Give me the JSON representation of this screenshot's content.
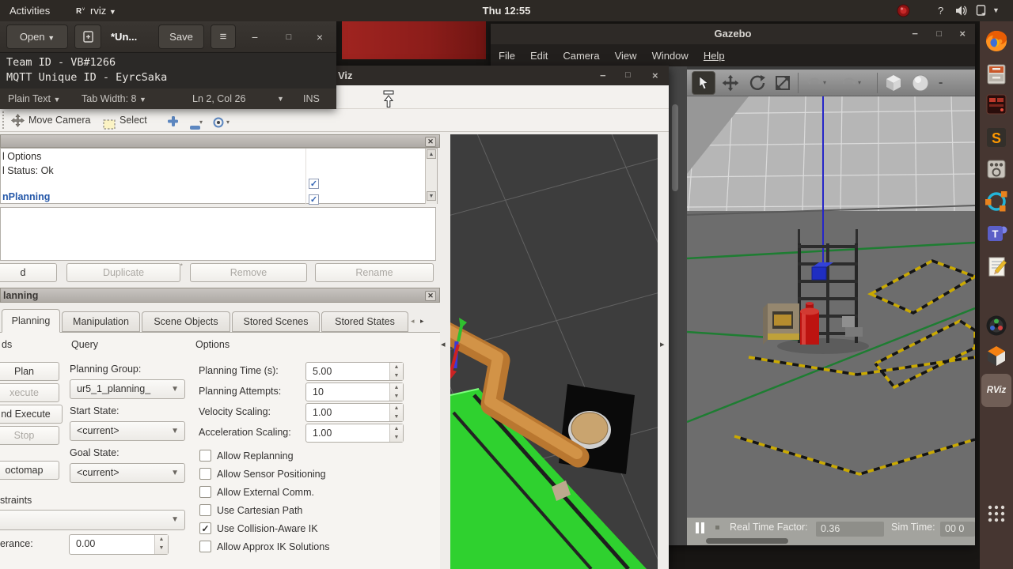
{
  "topbar": {
    "activities": "Activities",
    "app_name": "rviz",
    "clock": "Thu 12:55"
  },
  "gedit": {
    "open": "Open",
    "title": "*Un...",
    "save": "Save",
    "text_lines": [
      "Team ID - VB#1266",
      "MQTT Unique ID - EyrcSaka"
    ],
    "status": {
      "doc_type": "Plain Text",
      "tab_width": "Tab Width: 8",
      "cursor_pos": "Ln 2, Col 26",
      "mode": "INS"
    }
  },
  "rviz": {
    "title": "Viz",
    "toolbar": {
      "move_camera": "Move Camera",
      "select": "Select"
    },
    "displays": {
      "rows": [
        "l Options",
        "l Status: Ok"
      ],
      "planning_row": "nPlanning",
      "checks": [
        true,
        true
      ]
    },
    "display_buttons": {
      "add": "d",
      "duplicate": "Duplicate",
      "remove": "Remove",
      "rename": "Rename"
    },
    "motion_planning": {
      "title": "lanning",
      "tabs": [
        "Planning",
        "Manipulation",
        "Scene Objects",
        "Stored Scenes",
        "Stored States"
      ],
      "commands": {
        "label": "ds",
        "plan": "Plan",
        "execute": "xecute",
        "plan_execute": "nd Execute",
        "stop": "Stop",
        "octomap": "octomap"
      },
      "query": {
        "label": "Query",
        "planning_group_label": "Planning Group:",
        "planning_group_value": "ur5_1_planning_",
        "start_state_label": "Start State:",
        "start_state_value": "<current>",
        "goal_state_label": "Goal State:",
        "goal_state_value": "<current>"
      },
      "options": {
        "label": "Options",
        "rows": [
          {
            "label": "Planning Time (s):",
            "value": "5.00"
          },
          {
            "label": "Planning Attempts:",
            "value": "10"
          },
          {
            "label": "Velocity Scaling:",
            "value": "1.00"
          },
          {
            "label": "Acceleration Scaling:",
            "value": "1.00"
          }
        ],
        "checkboxes": [
          {
            "label": "Allow Replanning",
            "checked": false
          },
          {
            "label": "Allow Sensor Positioning",
            "checked": false
          },
          {
            "label": "Allow External Comm.",
            "checked": false
          },
          {
            "label": "Use Cartesian Path",
            "checked": false
          },
          {
            "label": "Use Collision-Aware IK",
            "checked": true
          },
          {
            "label": "Allow Approx IK Solutions",
            "checked": false
          }
        ]
      },
      "constraints": {
        "label": "straints",
        "tolerance_label": "erance:",
        "tolerance_value": "0.00"
      }
    }
  },
  "gazebo": {
    "title": "Gazebo",
    "menus": [
      "File",
      "Edit",
      "Camera",
      "View",
      "Window",
      "Help"
    ],
    "status": {
      "rtf_label": "Real Time Factor:",
      "rtf_value": "0.36",
      "sim_label": "Sim Time:",
      "sim_value": "00 0"
    }
  },
  "dock": {
    "rviz_label": "RViz",
    "items": [
      "firefox",
      "file-cabinet",
      "terminal",
      "sublime-text",
      "control-panel",
      "ros",
      "teams",
      "notes",
      "camera",
      "gazebo",
      "rviz",
      "show-applications"
    ]
  }
}
